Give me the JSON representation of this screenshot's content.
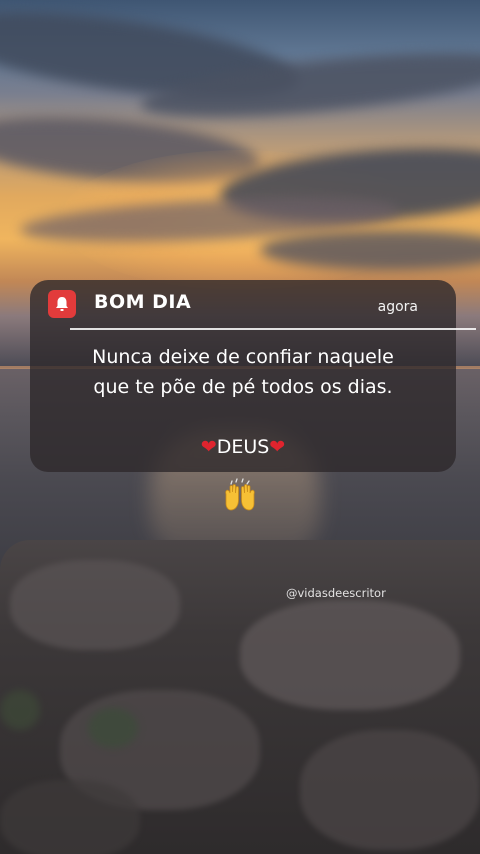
{
  "notification": {
    "app_icon": "bell-icon",
    "title": "BOM DIA",
    "time": "agora",
    "body_lines": [
      "Nunca deixe de confiar naquele",
      "que te põe de pé todos os dias."
    ],
    "signature": "DEUS",
    "signature_decoration": "heart-icon",
    "accent_color": "#e23b3b"
  },
  "emoji": {
    "name": "raising-hands-icon"
  },
  "watermark": {
    "text": "@vidasdeescritor"
  }
}
